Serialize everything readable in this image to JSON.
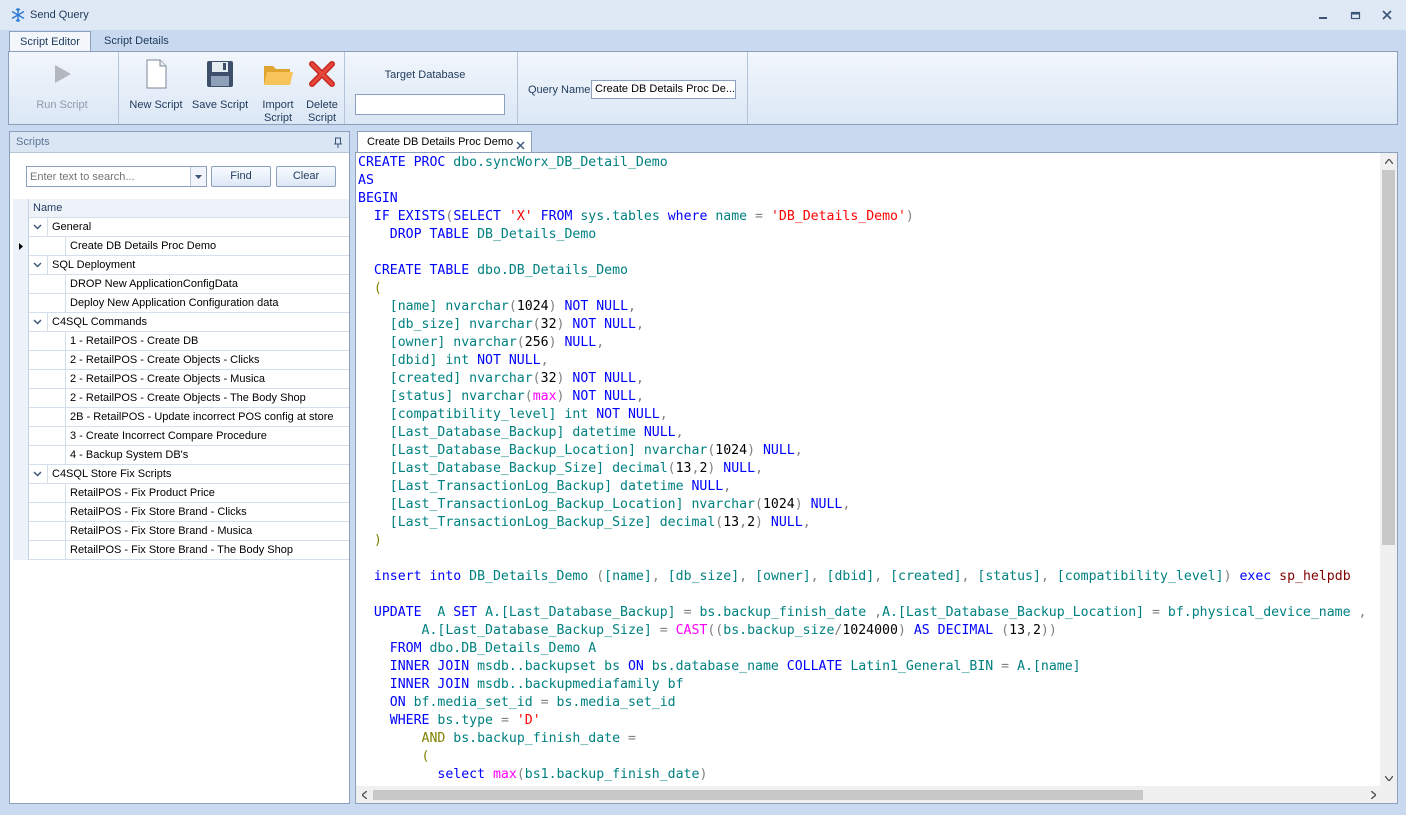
{
  "window": {
    "title": "Send Query",
    "icon": "snowflake-icon",
    "controls": [
      "minimize-icon",
      "restore-icon",
      "close-icon"
    ]
  },
  "ribbon_tabs": [
    {
      "label": "Script Editor",
      "active": true
    },
    {
      "label": "Script Details",
      "active": false
    }
  ],
  "ribbon": {
    "run_script": "Run Script",
    "new_script": "New Script",
    "save_script": "Save Script",
    "import_script_line1": "Import",
    "import_script_line2": "Script",
    "delete_script_line1": "Delete",
    "delete_script_line2": "Script",
    "target_database_label": "Target Database",
    "target_database_value": "",
    "query_name_label": "Query Name",
    "query_name_value": "Create DB Details Proc De..."
  },
  "scripts_panel": {
    "title": "Scripts",
    "search_placeholder": "Enter text to search...",
    "find_label": "Find",
    "clear_label": "Clear",
    "column_name": "Name",
    "rows": [
      {
        "type": "group",
        "label": "General"
      },
      {
        "type": "item",
        "label": "Create DB Details Proc Demo",
        "selected": true
      },
      {
        "type": "group",
        "label": "SQL Deployment"
      },
      {
        "type": "item",
        "label": "DROP New ApplicationConfigData"
      },
      {
        "type": "item",
        "label": "Deploy New Application Configuration data"
      },
      {
        "type": "group",
        "label": "C4SQL Commands"
      },
      {
        "type": "item",
        "label": "1 - RetailPOS - Create DB"
      },
      {
        "type": "item",
        "label": "2 - RetailPOS - Create Objects - Clicks"
      },
      {
        "type": "item",
        "label": "2 - RetailPOS - Create Objects - Musica"
      },
      {
        "type": "item",
        "label": "2 - RetailPOS - Create Objects - The Body Shop"
      },
      {
        "type": "item",
        "label": "2B - RetailPOS - Update incorrect POS config at store"
      },
      {
        "type": "item",
        "label": "3 - Create Incorrect Compare Procedure"
      },
      {
        "type": "item",
        "label": "4 - Backup System DB's"
      },
      {
        "type": "group",
        "label": "C4SQL Store Fix Scripts"
      },
      {
        "type": "item",
        "label": "RetailPOS - Fix Product Price"
      },
      {
        "type": "item",
        "label": "RetailPOS - Fix Store Brand - Clicks"
      },
      {
        "type": "item",
        "label": "RetailPOS - Fix Store Brand - Musica"
      },
      {
        "type": "item",
        "label": "RetailPOS - Fix Store Brand - The Body Shop"
      }
    ]
  },
  "editor": {
    "tab_label": "Create DB Details Proc Demo",
    "lines": [
      [
        [
          "kw",
          "CREATE PROC "
        ],
        [
          "id",
          "dbo.syncWorx_DB_Detail_Demo"
        ]
      ],
      [
        [
          "kw",
          "AS"
        ]
      ],
      [
        [
          "kw",
          "BEGIN"
        ]
      ],
      [
        [
          "id",
          "  "
        ],
        [
          "kw",
          "IF EXISTS"
        ],
        [
          "gr",
          "("
        ],
        [
          "kw",
          "SELECT "
        ],
        [
          "st",
          "'X'"
        ],
        [
          "kw",
          " FROM "
        ],
        [
          "id",
          "sys.tables "
        ],
        [
          "kw",
          "where "
        ],
        [
          "id",
          "name "
        ],
        [
          "gr",
          "= "
        ],
        [
          "st",
          "'DB_Details_Demo'"
        ],
        [
          "gr",
          ")"
        ]
      ],
      [
        [
          "id",
          "    "
        ],
        [
          "kw",
          "DROP TABLE "
        ],
        [
          "id",
          "DB_Details_Demo"
        ]
      ],
      [
        [
          "id",
          ""
        ]
      ],
      [
        [
          "id",
          "  "
        ],
        [
          "kw",
          "CREATE TABLE "
        ],
        [
          "id",
          "dbo.DB_Details_Demo"
        ]
      ],
      [
        [
          "id",
          "  "
        ],
        [
          "op",
          "("
        ]
      ],
      [
        [
          "id",
          "    [name] "
        ],
        [
          "id",
          "nvarchar"
        ],
        [
          "gr",
          "("
        ],
        [
          "pl",
          "1024"
        ],
        [
          "gr",
          ")"
        ],
        [
          "kw",
          " NOT NULL"
        ],
        [
          "gr",
          ","
        ]
      ],
      [
        [
          "id",
          "    [db_size] nvarchar"
        ],
        [
          "gr",
          "("
        ],
        [
          "pl",
          "32"
        ],
        [
          "gr",
          ")"
        ],
        [
          "kw",
          " NOT NULL"
        ],
        [
          "gr",
          ","
        ]
      ],
      [
        [
          "id",
          "    [owner] nvarchar"
        ],
        [
          "gr",
          "("
        ],
        [
          "pl",
          "256"
        ],
        [
          "gr",
          ")"
        ],
        [
          "kw",
          " NULL"
        ],
        [
          "gr",
          ","
        ]
      ],
      [
        [
          "id",
          "    [dbid] int"
        ],
        [
          "kw",
          " NOT NULL"
        ],
        [
          "gr",
          ","
        ]
      ],
      [
        [
          "id",
          "    [created] nvarchar"
        ],
        [
          "gr",
          "("
        ],
        [
          "pl",
          "32"
        ],
        [
          "gr",
          ")"
        ],
        [
          "kw",
          " NOT NULL"
        ],
        [
          "gr",
          ","
        ]
      ],
      [
        [
          "id",
          "    [status] nvarchar"
        ],
        [
          "gr",
          "("
        ],
        [
          "fn",
          "max"
        ],
        [
          "gr",
          ")"
        ],
        [
          "kw",
          " NOT NULL"
        ],
        [
          "gr",
          ","
        ]
      ],
      [
        [
          "id",
          "    [compatibility_level] int"
        ],
        [
          "kw",
          " NOT NULL"
        ],
        [
          "gr",
          ","
        ]
      ],
      [
        [
          "id",
          "    [Last_Database_Backup] datetime"
        ],
        [
          "kw",
          " NULL"
        ],
        [
          "gr",
          ","
        ]
      ],
      [
        [
          "id",
          "    [Last_Database_Backup_Location] nvarchar"
        ],
        [
          "gr",
          "("
        ],
        [
          "pl",
          "1024"
        ],
        [
          "gr",
          ")"
        ],
        [
          "kw",
          " NULL"
        ],
        [
          "gr",
          ","
        ]
      ],
      [
        [
          "id",
          "    [Last_Database_Backup_Size] decimal"
        ],
        [
          "gr",
          "("
        ],
        [
          "pl",
          "13"
        ],
        [
          "gr",
          ","
        ],
        [
          "pl",
          "2"
        ],
        [
          "gr",
          ")"
        ],
        [
          "kw",
          " NULL"
        ],
        [
          "gr",
          ","
        ]
      ],
      [
        [
          "id",
          "    [Last_TransactionLog_Backup] datetime"
        ],
        [
          "kw",
          " NULL"
        ],
        [
          "gr",
          ","
        ]
      ],
      [
        [
          "id",
          "    [Last_TransactionLog_Backup_Location] nvarchar"
        ],
        [
          "gr",
          "("
        ],
        [
          "pl",
          "1024"
        ],
        [
          "gr",
          ")"
        ],
        [
          "kw",
          " NULL"
        ],
        [
          "gr",
          ","
        ]
      ],
      [
        [
          "id",
          "    [Last_TransactionLog_Backup_Size] decimal"
        ],
        [
          "gr",
          "("
        ],
        [
          "pl",
          "13"
        ],
        [
          "gr",
          ","
        ],
        [
          "pl",
          "2"
        ],
        [
          "gr",
          ")"
        ],
        [
          "kw",
          " NULL"
        ],
        [
          "gr",
          ","
        ]
      ],
      [
        [
          "id",
          "  "
        ],
        [
          "op",
          ")"
        ]
      ],
      [
        [
          "id",
          ""
        ]
      ],
      [
        [
          "id",
          "  "
        ],
        [
          "kw",
          "insert into "
        ],
        [
          "id",
          "DB_Details_Demo "
        ],
        [
          "gr",
          "("
        ],
        [
          "id",
          "[name]"
        ],
        [
          "gr",
          ", "
        ],
        [
          "id",
          "[db_size]"
        ],
        [
          "gr",
          ", "
        ],
        [
          "id",
          "[owner]"
        ],
        [
          "gr",
          ", "
        ],
        [
          "id",
          "[dbid]"
        ],
        [
          "gr",
          ", "
        ],
        [
          "id",
          "[created]"
        ],
        [
          "gr",
          ", "
        ],
        [
          "id",
          "[status]"
        ],
        [
          "gr",
          ", "
        ],
        [
          "id",
          "[compatibility_level]"
        ],
        [
          "gr",
          ") "
        ],
        [
          "kw",
          "exec "
        ],
        [
          "sp",
          "sp_helpdb"
        ]
      ],
      [
        [
          "id",
          ""
        ]
      ],
      [
        [
          "id",
          "  "
        ],
        [
          "kw",
          "UPDATE"
        ],
        [
          "id",
          "  A "
        ],
        [
          "kw",
          "SET "
        ],
        [
          "id",
          "A.[Last_Database_Backup] "
        ],
        [
          "gr",
          "= "
        ],
        [
          "id",
          "bs.backup_finish_date "
        ],
        [
          "gr",
          ","
        ],
        [
          "id",
          "A.[Last_Database_Backup_Location] "
        ],
        [
          "gr",
          "= "
        ],
        [
          "id",
          "bf.physical_device_name "
        ],
        [
          "gr",
          ","
        ]
      ],
      [
        [
          "id",
          "        A.[Last_Database_Backup_Size] "
        ],
        [
          "gr",
          "= "
        ],
        [
          "fn",
          "CAST"
        ],
        [
          "gr",
          "(("
        ],
        [
          "id",
          "bs.backup_size"
        ],
        [
          "gr",
          "/"
        ],
        [
          "pl",
          "1024000"
        ],
        [
          "gr",
          ") "
        ],
        [
          "kw",
          "AS DECIMAL "
        ],
        [
          "gr",
          "("
        ],
        [
          "pl",
          "13"
        ],
        [
          "gr",
          ","
        ],
        [
          "pl",
          "2"
        ],
        [
          "gr",
          "))"
        ]
      ],
      [
        [
          "id",
          "    "
        ],
        [
          "kw",
          "FROM "
        ],
        [
          "id",
          "dbo.DB_Details_Demo A"
        ]
      ],
      [
        [
          "id",
          "    "
        ],
        [
          "kw",
          "INNER JOIN "
        ],
        [
          "id",
          "msdb..backupset bs "
        ],
        [
          "kw",
          "ON "
        ],
        [
          "id",
          "bs.database_name "
        ],
        [
          "kw",
          "COLLATE "
        ],
        [
          "id",
          "Latin1_General_BIN "
        ],
        [
          "gr",
          "= "
        ],
        [
          "id",
          "A.[name]"
        ]
      ],
      [
        [
          "id",
          "    "
        ],
        [
          "kw",
          "INNER JOIN "
        ],
        [
          "id",
          "msdb..backupmediafamily bf"
        ]
      ],
      [
        [
          "id",
          "    "
        ],
        [
          "kw",
          "ON "
        ],
        [
          "id",
          "bf.media_set_id "
        ],
        [
          "gr",
          "= "
        ],
        [
          "id",
          "bs.media_set_id"
        ]
      ],
      [
        [
          "id",
          "    "
        ],
        [
          "kw",
          "WHERE "
        ],
        [
          "id",
          "bs.type "
        ],
        [
          "gr",
          "= "
        ],
        [
          "st",
          "'D'"
        ]
      ],
      [
        [
          "id",
          "        "
        ],
        [
          "op",
          "AND "
        ],
        [
          "id",
          "bs.backup_finish_date "
        ],
        [
          "gr",
          "="
        ]
      ],
      [
        [
          "id",
          "        "
        ],
        [
          "op",
          "("
        ]
      ],
      [
        [
          "id",
          "          "
        ],
        [
          "kw",
          "select "
        ],
        [
          "fn",
          "max"
        ],
        [
          "gr",
          "("
        ],
        [
          "id",
          "bs1.backup_finish_date"
        ],
        [
          "gr",
          ")"
        ]
      ]
    ]
  }
}
